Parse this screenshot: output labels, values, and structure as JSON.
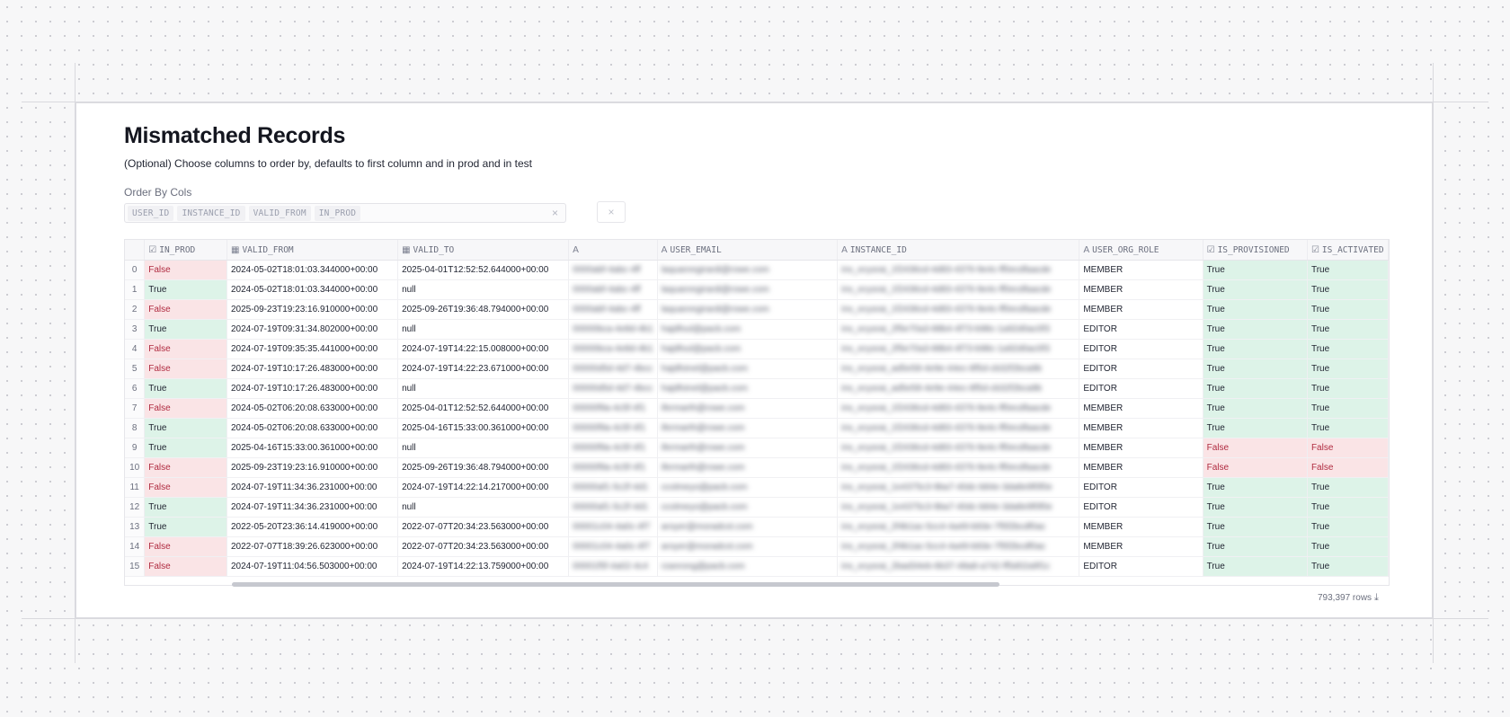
{
  "page": {
    "title": "Mismatched Records",
    "subtitle": "(Optional) Choose columns to order by, defaults to first column and in prod and in test",
    "order_by_label": "Order By Cols",
    "order_by_chips": [
      "USER_ID",
      "INSTANCE_ID",
      "VALID_FROM",
      "IN_PROD"
    ],
    "clear_glyph": "×"
  },
  "table": {
    "columns": [
      {
        "name": "",
        "icon": ""
      },
      {
        "name": "IN_PROD",
        "icon": "checkbox-icon"
      },
      {
        "name": "VALID_FROM",
        "icon": "calendar-icon"
      },
      {
        "name": "VALID_TO",
        "icon": "calendar-icon"
      },
      {
        "name": "",
        "icon": "text-type-icon"
      },
      {
        "name": "USER_EMAIL",
        "icon": "text-type-icon"
      },
      {
        "name": "INSTANCE_ID",
        "icon": "text-type-icon"
      },
      {
        "name": "USER_ORG_ROLE",
        "icon": "text-type-icon"
      },
      {
        "name": "IS_PROVISIONED",
        "icon": "checkbox-icon"
      },
      {
        "name": "IS_ACTIVATED",
        "icon": "checkbox-icon"
      }
    ],
    "rows": [
      {
        "idx": "0",
        "in_prod": "False",
        "valid_from": "2024-05-02T18:01:03.344000+00:00",
        "valid_to": "2025-04-01T12:52:52.644000+00:00",
        "user_id": "0000abf-4abc-4ff",
        "user_email": "laquanregirardi@rowe.com",
        "instance_id": "ins_ecysrai_1f2436cd-4d83-4376-9e4c-ff0ecdfaacde",
        "role": "MEMBER",
        "is_provisioned": "True",
        "is_activated": "True"
      },
      {
        "idx": "1",
        "in_prod": "True",
        "valid_from": "2024-05-02T18:01:03.344000+00:00",
        "valid_to": "null",
        "user_id": "0000abf-4abc-4ff",
        "user_email": "laquanregirardi@rowe.com",
        "instance_id": "ins_ecysrai_1f2436cd-4d83-4376-9e4c-ff0ecdfaacde",
        "role": "MEMBER",
        "is_provisioned": "True",
        "is_activated": "True"
      },
      {
        "idx": "2",
        "in_prod": "False",
        "valid_from": "2025-09-23T19:23:16.910000+00:00",
        "valid_to": "2025-09-26T19:36:48.794000+00:00",
        "user_id": "0000abf-4abc-4ff",
        "user_email": "laquanregirardi@rowe.com",
        "instance_id": "ins_ecysrai_1f2436cd-4d83-4376-9e4c-ff0ecdfaacde",
        "role": "MEMBER",
        "is_provisioned": "True",
        "is_activated": "True"
      },
      {
        "idx": "3",
        "in_prod": "True",
        "valid_from": "2024-07-19T09:31:34.802000+00:00",
        "valid_to": "null",
        "user_id": "00000bca-4e8d-4b1",
        "user_email": "hajdfoul@pacb.com",
        "instance_id": "ins_ecysrai_2f5e70a3-88b4-4f73-b98c-1a92d0ac0f3",
        "role": "EDITOR",
        "is_provisioned": "True",
        "is_activated": "True"
      },
      {
        "idx": "4",
        "in_prod": "False",
        "valid_from": "2024-07-19T09:35:35.441000+00:00",
        "valid_to": "2024-07-19T14:22:15.008000+00:00",
        "user_id": "00000bca-4e8d-4b1",
        "user_email": "hajdfoul@pacb.com",
        "instance_id": "ins_ecysrai_2f5e70a3-88b4-4f73-b98c-1a92d0ac0f3",
        "role": "EDITOR",
        "is_provisioned": "True",
        "is_activated": "True"
      },
      {
        "idx": "5",
        "in_prod": "False",
        "valid_from": "2024-07-19T10:17:26.483000+00:00",
        "valid_to": "2024-07-19T14:22:23.671000+00:00",
        "user_id": "00000d5d-4d7-4bcc",
        "user_email": "hajdfoinel@pacb.com",
        "instance_id": "ins_ecysrai_ad5e58-4e9e-44ec-8f5d-cb32f2bca9b",
        "role": "EDITOR",
        "is_provisioned": "True",
        "is_activated": "True"
      },
      {
        "idx": "6",
        "in_prod": "True",
        "valid_from": "2024-07-19T10:17:26.483000+00:00",
        "valid_to": "null",
        "user_id": "00000d5d-4d7-4bcc",
        "user_email": "hajdfoinel@pacb.com",
        "instance_id": "ins_ecysrai_ad5e58-4e9e-44ec-8f5d-cb32f2bca9b",
        "role": "EDITOR",
        "is_provisioned": "True",
        "is_activated": "True"
      },
      {
        "idx": "7",
        "in_prod": "False",
        "valid_from": "2024-05-02T06:20:08.633000+00:00",
        "valid_to": "2025-04-01T12:52:52.644000+00:00",
        "user_id": "00000f9a-4c5f-4f1",
        "user_email": "ifermarth@rowe.com",
        "instance_id": "ins_ecysrai_1f2436cd-4d83-4376-9e4c-ff0ecdfaacde",
        "role": "MEMBER",
        "is_provisioned": "True",
        "is_activated": "True"
      },
      {
        "idx": "8",
        "in_prod": "True",
        "valid_from": "2024-05-02T06:20:08.633000+00:00",
        "valid_to": "2025-04-16T15:33:00.361000+00:00",
        "user_id": "00000f9a-4c5f-4f1",
        "user_email": "ifermarth@rowe.com",
        "instance_id": "ins_ecysrai_1f2436cd-4d83-4376-9e4c-ff0ecdfaacde",
        "role": "MEMBER",
        "is_provisioned": "True",
        "is_activated": "True"
      },
      {
        "idx": "9",
        "in_prod": "True",
        "valid_from": "2025-04-16T15:33:00.361000+00:00",
        "valid_to": "null",
        "user_id": "00000f9a-4c5f-4f1",
        "user_email": "ifermarth@rowe.com",
        "instance_id": "ins_ecysrai_1f2436cd-4d83-4376-9e4c-ff0ecdfaacde",
        "role": "MEMBER",
        "is_provisioned": "False",
        "is_activated": "False"
      },
      {
        "idx": "10",
        "in_prod": "False",
        "valid_from": "2025-09-23T19:23:16.910000+00:00",
        "valid_to": "2025-09-26T19:36:48.794000+00:00",
        "user_id": "00000f9a-4c5f-4f1",
        "user_email": "ifermarth@rowe.com",
        "instance_id": "ins_ecysrai_1f2436cd-4d83-4376-9e4c-ff0ecdfaacde",
        "role": "MEMBER",
        "is_provisioned": "False",
        "is_activated": "False"
      },
      {
        "idx": "11",
        "in_prod": "False",
        "valid_from": "2024-07-19T11:34:36.231000+00:00",
        "valid_to": "2024-07-19T14:22:14.217000+00:00",
        "user_id": "00000af1-5c2f-4d1",
        "user_email": "ccolmeyo@pacb.com",
        "instance_id": "ins_ecysrai_1e4375c3-9ba7-40dc-b84e-3da8e9f0f0e",
        "role": "EDITOR",
        "is_provisioned": "True",
        "is_activated": "True"
      },
      {
        "idx": "12",
        "in_prod": "True",
        "valid_from": "2024-07-19T11:34:36.231000+00:00",
        "valid_to": "null",
        "user_id": "00000af1-5c2f-4d1",
        "user_email": "ccolmeyo@pacb.com",
        "instance_id": "ins_ecysrai_1e4375c3-9ba7-40dc-b84e-3da8e9f0f0e",
        "role": "EDITOR",
        "is_provisioned": "True",
        "is_activated": "True"
      },
      {
        "idx": "13",
        "in_prod": "True",
        "valid_from": "2022-05-20T23:36:14.419000+00:00",
        "valid_to": "2022-07-07T20:34:23.563000+00:00",
        "user_id": "00001c04-4a0c-4f7",
        "user_email": "aroyer@moradcot.com",
        "instance_id": "ins_ecysrai_2f4b1ac-5cc4-4a49-b93e-7f5f2bcdf0ac",
        "role": "MEMBER",
        "is_provisioned": "True",
        "is_activated": "True"
      },
      {
        "idx": "14",
        "in_prod": "False",
        "valid_from": "2022-07-07T18:39:26.623000+00:00",
        "valid_to": "2022-07-07T20:34:23.563000+00:00",
        "user_id": "00001c04-4a0c-4f7",
        "user_email": "aroyer@moradcot.com",
        "instance_id": "ins_ecysrai_2f4b1ac-5cc4-4a49-b93e-7f5f2bcdf0ac",
        "role": "MEMBER",
        "is_provisioned": "True",
        "is_activated": "True"
      },
      {
        "idx": "15",
        "in_prod": "False",
        "valid_from": "2024-07-19T11:04:56.503000+00:00",
        "valid_to": "2024-07-19T14:22:13.759000+00:00",
        "user_id": "00001f5f-4a02-4c4",
        "user_email": "rzanrong@pacb.com",
        "instance_id": "ins_ecysrai_2bad34eb-6b37-48a8-a742-ff5d02a9f1c",
        "role": "EDITOR",
        "is_provisioned": "True",
        "is_activated": "True"
      }
    ],
    "row_count": "793,397 rows"
  },
  "icons": {
    "checkbox": "☑",
    "calendar": "▦",
    "text_type": "A",
    "download": "⤓"
  },
  "colors": {
    "true_bg": "#ddf3e8",
    "false_bg": "#fae4e6",
    "false_text": "#b02b40"
  }
}
